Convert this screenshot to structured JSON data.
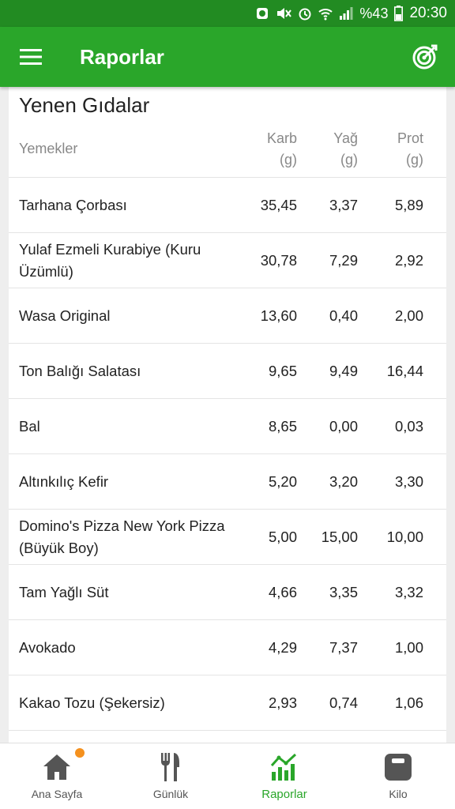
{
  "status": {
    "battery_percent": "%43",
    "time": "20:30"
  },
  "app_bar": {
    "title": "Raporlar"
  },
  "card": {
    "title": "Yenen Gıdalar",
    "columns": {
      "name": "Yemekler",
      "carb": [
        "Karb",
        "(g)"
      ],
      "fat": [
        "Yağ",
        "(g)"
      ],
      "prot": [
        "Prot",
        "(g)"
      ]
    },
    "rows": [
      {
        "name": "Tarhana Çorbası",
        "carb": "35,45",
        "fat": "3,37",
        "prot": "5,89"
      },
      {
        "name": "Yulaf Ezmeli Kurabiye (Kuru Üzümlü)",
        "carb": "30,78",
        "fat": "7,29",
        "prot": "2,92"
      },
      {
        "name": "Wasa Original",
        "carb": "13,60",
        "fat": "0,40",
        "prot": "2,00"
      },
      {
        "name": "Ton Balığı Salatası",
        "carb": "9,65",
        "fat": "9,49",
        "prot": "16,44"
      },
      {
        "name": "Bal",
        "carb": "8,65",
        "fat": "0,00",
        "prot": "0,03"
      },
      {
        "name": "Altınkılıç Kefir",
        "carb": "5,20",
        "fat": "3,20",
        "prot": "3,30"
      },
      {
        "name": "Domino's Pizza New York Pizza (Büyük Boy)",
        "carb": "5,00",
        "fat": "15,00",
        "prot": "10,00"
      },
      {
        "name": "Tam Yağlı Süt",
        "carb": "4,66",
        "fat": "3,35",
        "prot": "3,32"
      },
      {
        "name": "Avokado",
        "carb": "4,29",
        "fat": "7,37",
        "prot": "1,00"
      },
      {
        "name": "Kakao Tozu (Şekersiz)",
        "carb": "2,93",
        "fat": "0,74",
        "prot": "1,06"
      }
    ]
  },
  "bottom_nav": [
    {
      "label": "Ana Sayfa",
      "icon": "home-icon"
    },
    {
      "label": "Günlük",
      "icon": "fork-knife-icon"
    },
    {
      "label": "Raporlar",
      "icon": "chart-icon"
    },
    {
      "label": "Kilo",
      "icon": "scale-icon"
    }
  ],
  "colors": {
    "primary": "#2aa62a",
    "status_bar": "#228b22",
    "badge": "#f5911e"
  }
}
